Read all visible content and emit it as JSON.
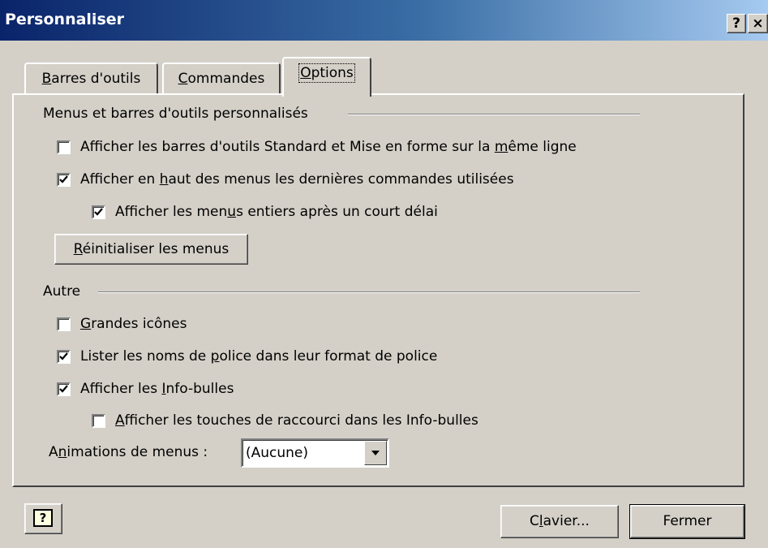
{
  "window": {
    "title": "Personnaliser",
    "help_glyph": "?",
    "close_glyph": "×"
  },
  "tabs": [
    {
      "label_pre": "",
      "label_key": "B",
      "label_post": "arres d'outils",
      "active": false
    },
    {
      "label_pre": "",
      "label_key": "C",
      "label_post": "ommandes",
      "active": false
    },
    {
      "label_pre": "",
      "label_key": "O",
      "label_post": "ptions",
      "active": true
    }
  ],
  "group_menus": {
    "title": "Menus et barres d'outils personnalisés",
    "options": [
      {
        "pre": "Afficher les barres d'outils Standard et Mise en forme sur la ",
        "key": "m",
        "post": "ême ligne",
        "checked": false
      },
      {
        "pre": "Afficher en ",
        "key": "h",
        "post": "aut des menus les dernières commandes utilisées",
        "checked": true
      },
      {
        "pre": "Afficher les men",
        "key": "u",
        "post": "s entiers après un court délai",
        "checked": true
      }
    ],
    "reset_button": {
      "pre": "",
      "key": "R",
      "post": "éinitialiser les menus"
    }
  },
  "group_other": {
    "title": "Autre",
    "options": [
      {
        "pre": "",
        "key": "G",
        "post": "randes icônes",
        "checked": false
      },
      {
        "pre": "Lister les noms de ",
        "key": "p",
        "post": "olice dans leur format de police",
        "checked": true
      },
      {
        "pre": "Afficher les ",
        "key": "I",
        "post": "nfo-bulles",
        "checked": true
      },
      {
        "pre": "",
        "key": "A",
        "post": "fficher les touches de raccourci dans les Info-bulles",
        "checked": false
      }
    ],
    "animations_label": {
      "pre": "A",
      "key": "n",
      "post": "imations de menus :"
    },
    "animations_value": "(Aucune)"
  },
  "footer": {
    "help_icon_glyph": "?",
    "keyboard_button": {
      "pre": "C",
      "key": "l",
      "post": "avier..."
    },
    "close_button": "Fermer"
  }
}
